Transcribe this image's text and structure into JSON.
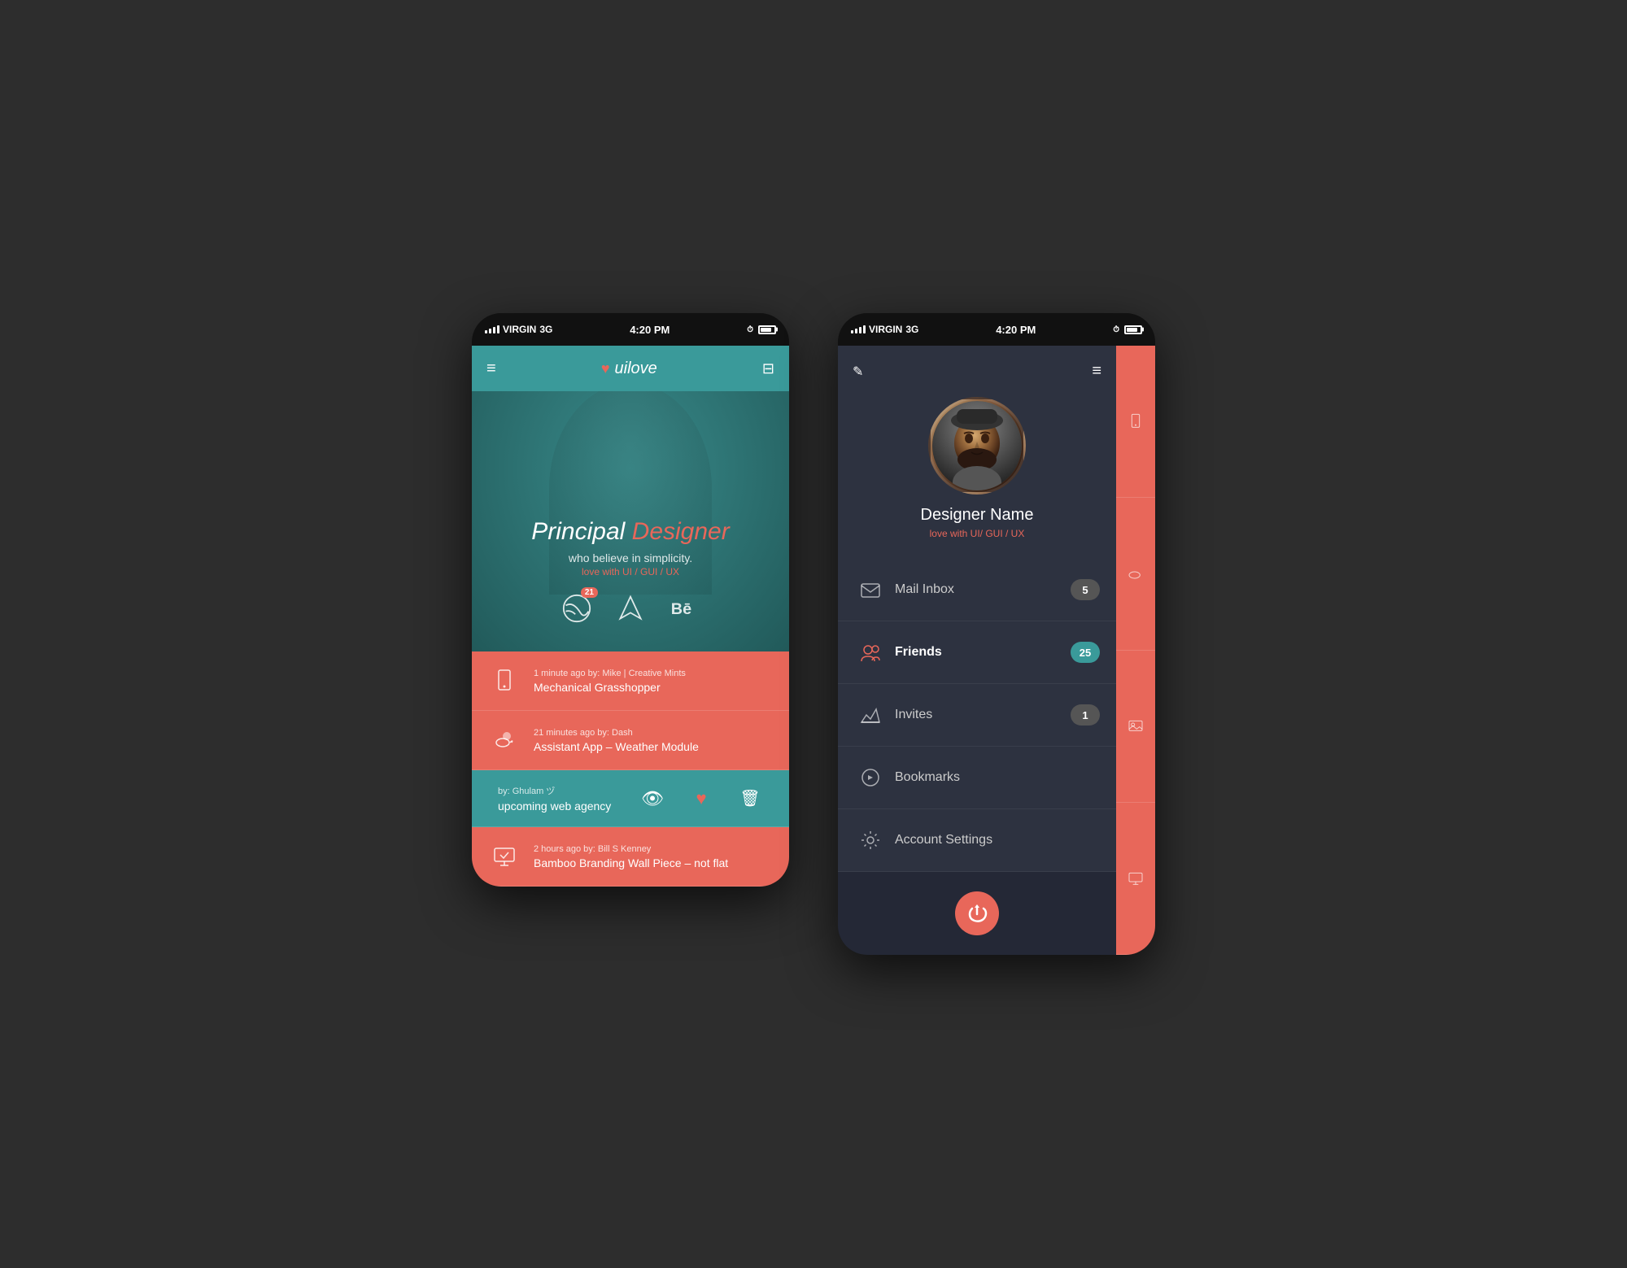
{
  "screen1": {
    "status_bar": {
      "carrier": "VIRGIN",
      "network": "3G",
      "time": "4:20 PM"
    },
    "header": {
      "logo": "uilove",
      "hamburger_label": "≡",
      "briefcase_label": "⊡"
    },
    "hero": {
      "title_plain": "Principal",
      "title_highlight": "Designer",
      "subtitle": "who believe in simplicity.",
      "tagline": "love with UI / GUI / UX"
    },
    "social_icons": [
      {
        "name": "dribbble",
        "badge": "21"
      },
      {
        "name": "arrivals",
        "badge": ""
      },
      {
        "name": "behance",
        "badge": ""
      }
    ],
    "feed_items": [
      {
        "icon_type": "phone",
        "meta": "1 minute ago    by: Mike | Creative Mints",
        "title": "Mechanical Grasshopper"
      },
      {
        "icon_type": "cloud",
        "meta": "21 minutes ago    by: Dash",
        "title": "Assistant App – Weather Module"
      },
      {
        "icon_type": "web",
        "meta": "by: Ghulam ヅ",
        "title": "upcoming web agency",
        "swiped": true
      },
      {
        "icon_type": "monitor",
        "meta": "2 hours ago    by: Bill S Kenney",
        "title": "Bamboo Branding Wall Piece – not flat"
      }
    ],
    "swipe_actions": {
      "view": "👁",
      "like": "♥",
      "delete": "🗑"
    }
  },
  "screen2": {
    "status_bar": {
      "carrier": "VIRGIN",
      "network": "3G",
      "time": "4:20 PM"
    },
    "profile": {
      "name": "Designer Name",
      "tagline": "love with UI/ GUI / UX"
    },
    "menu_items": [
      {
        "icon": "mail",
        "label": "Mail Inbox",
        "badge": "5",
        "badge_type": "gray"
      },
      {
        "icon": "friends",
        "label": "Friends",
        "badge": "25",
        "badge_type": "teal"
      },
      {
        "icon": "invite",
        "label": "Invites",
        "badge": "1",
        "badge_type": "gray"
      },
      {
        "icon": "bookmark",
        "label": "Bookmarks",
        "badge": "",
        "badge_type": ""
      },
      {
        "icon": "settings",
        "label": "Account Settings",
        "badge": "",
        "badge_type": ""
      }
    ],
    "logout_icon": "⏏",
    "side_strip_icons": [
      "📱",
      "☁",
      "🖼",
      "🖥"
    ]
  },
  "colors": {
    "teal": "#3a9a9a",
    "coral": "#e8675a",
    "dark": "#2d3240",
    "darker": "#242836",
    "gray_bg": "#555"
  }
}
